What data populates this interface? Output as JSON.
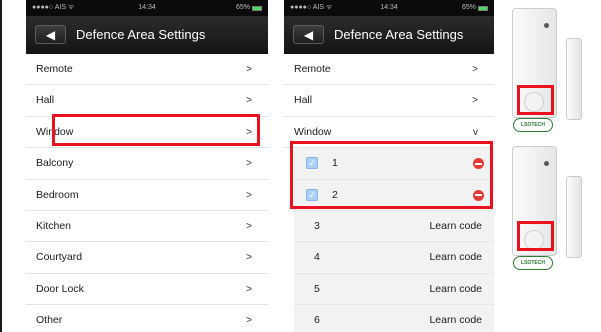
{
  "status_bar": {
    "carrier": "●●●●○ AIS ᯤ",
    "time": "14:34",
    "battery": "65%"
  },
  "nav": {
    "back_icon": "back-arrow-icon",
    "title": "Defence Area Settings"
  },
  "screen1": {
    "rows": [
      {
        "label": "Remote",
        "chevron": ">"
      },
      {
        "label": "Hall",
        "chevron": ">"
      },
      {
        "label": "Window",
        "chevron": ">"
      },
      {
        "label": "Balcony",
        "chevron": ">"
      },
      {
        "label": "Bedroom",
        "chevron": ">"
      },
      {
        "label": "Kitchen",
        "chevron": ">"
      },
      {
        "label": "Courtyard",
        "chevron": ">"
      },
      {
        "label": "Door Lock",
        "chevron": ">"
      },
      {
        "label": "Other",
        "chevron": ">"
      }
    ]
  },
  "screen2": {
    "rows": [
      {
        "label": "Remote",
        "chevron": ">"
      },
      {
        "label": "Hall",
        "chevron": ">"
      },
      {
        "label": "Window",
        "chevron": "v"
      }
    ],
    "learned": [
      {
        "label": "1",
        "checked": true
      },
      {
        "label": "2",
        "checked": true
      }
    ],
    "slots": [
      {
        "label": "3",
        "action": "Learn code"
      },
      {
        "label": "4",
        "action": "Learn code"
      },
      {
        "label": "5",
        "action": "Learn code"
      },
      {
        "label": "6",
        "action": "Learn code"
      }
    ]
  },
  "device": {
    "brand": "LSOTECH"
  },
  "colors": {
    "highlight": "#e8131f",
    "nav_bar": "#1c1c1c",
    "checkbox": "#a9d1f5",
    "delete": "#e53935"
  }
}
